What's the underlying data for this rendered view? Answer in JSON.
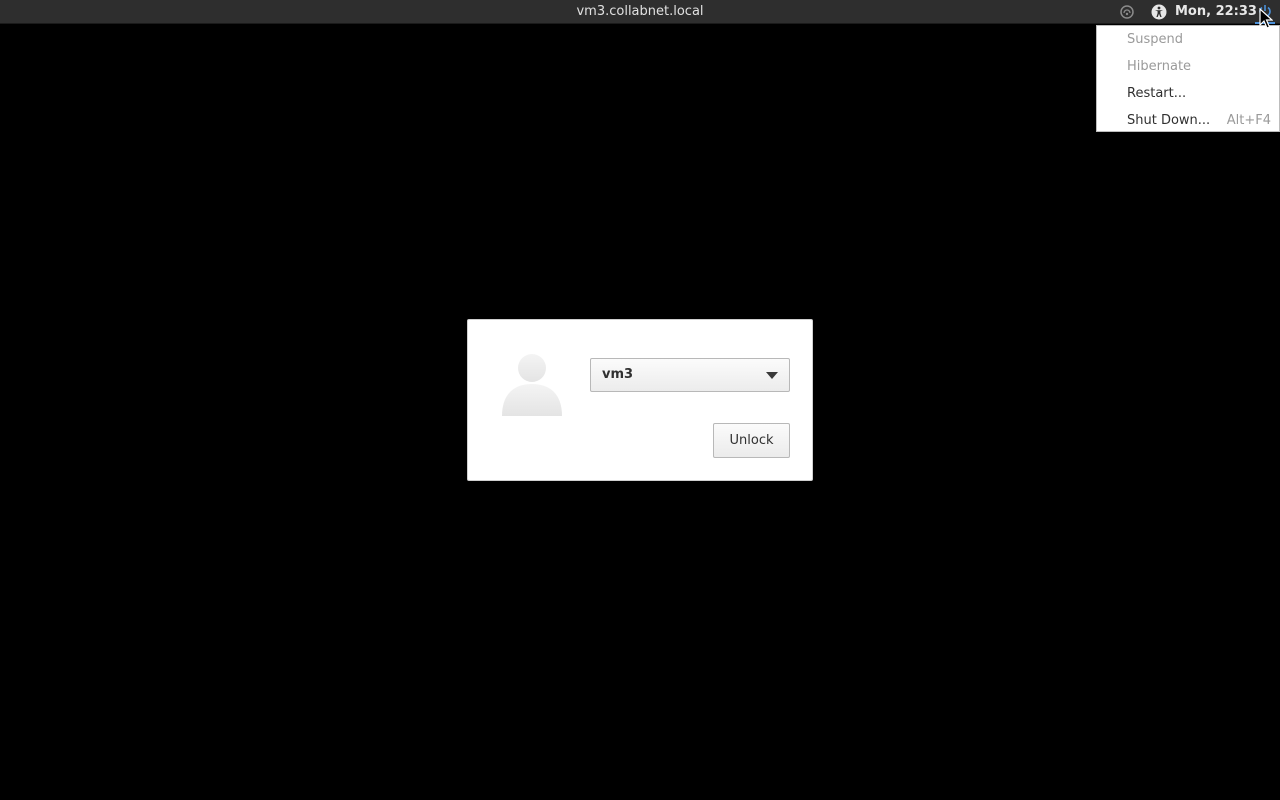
{
  "top_panel": {
    "host_title": "vm3.collabnet.local",
    "clock": "Mon, 22:33",
    "indicators": {
      "network_icon": "network-offline-icon",
      "accessibility_icon": "accessibility-icon",
      "power_icon": "power-icon"
    }
  },
  "power_menu": {
    "items": [
      {
        "label": "Suspend",
        "enabled": false,
        "accel": ""
      },
      {
        "label": "Hibernate",
        "enabled": false,
        "accel": ""
      },
      {
        "label": "Restart...",
        "enabled": true,
        "accel": ""
      },
      {
        "label": "Shut Down...",
        "enabled": true,
        "accel": "Alt+F4"
      }
    ]
  },
  "lock_dialog": {
    "user_select": {
      "value": "vm3"
    },
    "unlock_label": "Unlock"
  },
  "colors": {
    "background": "#000000",
    "panel": "#2e2e2e",
    "accent": "#4a90d9"
  }
}
